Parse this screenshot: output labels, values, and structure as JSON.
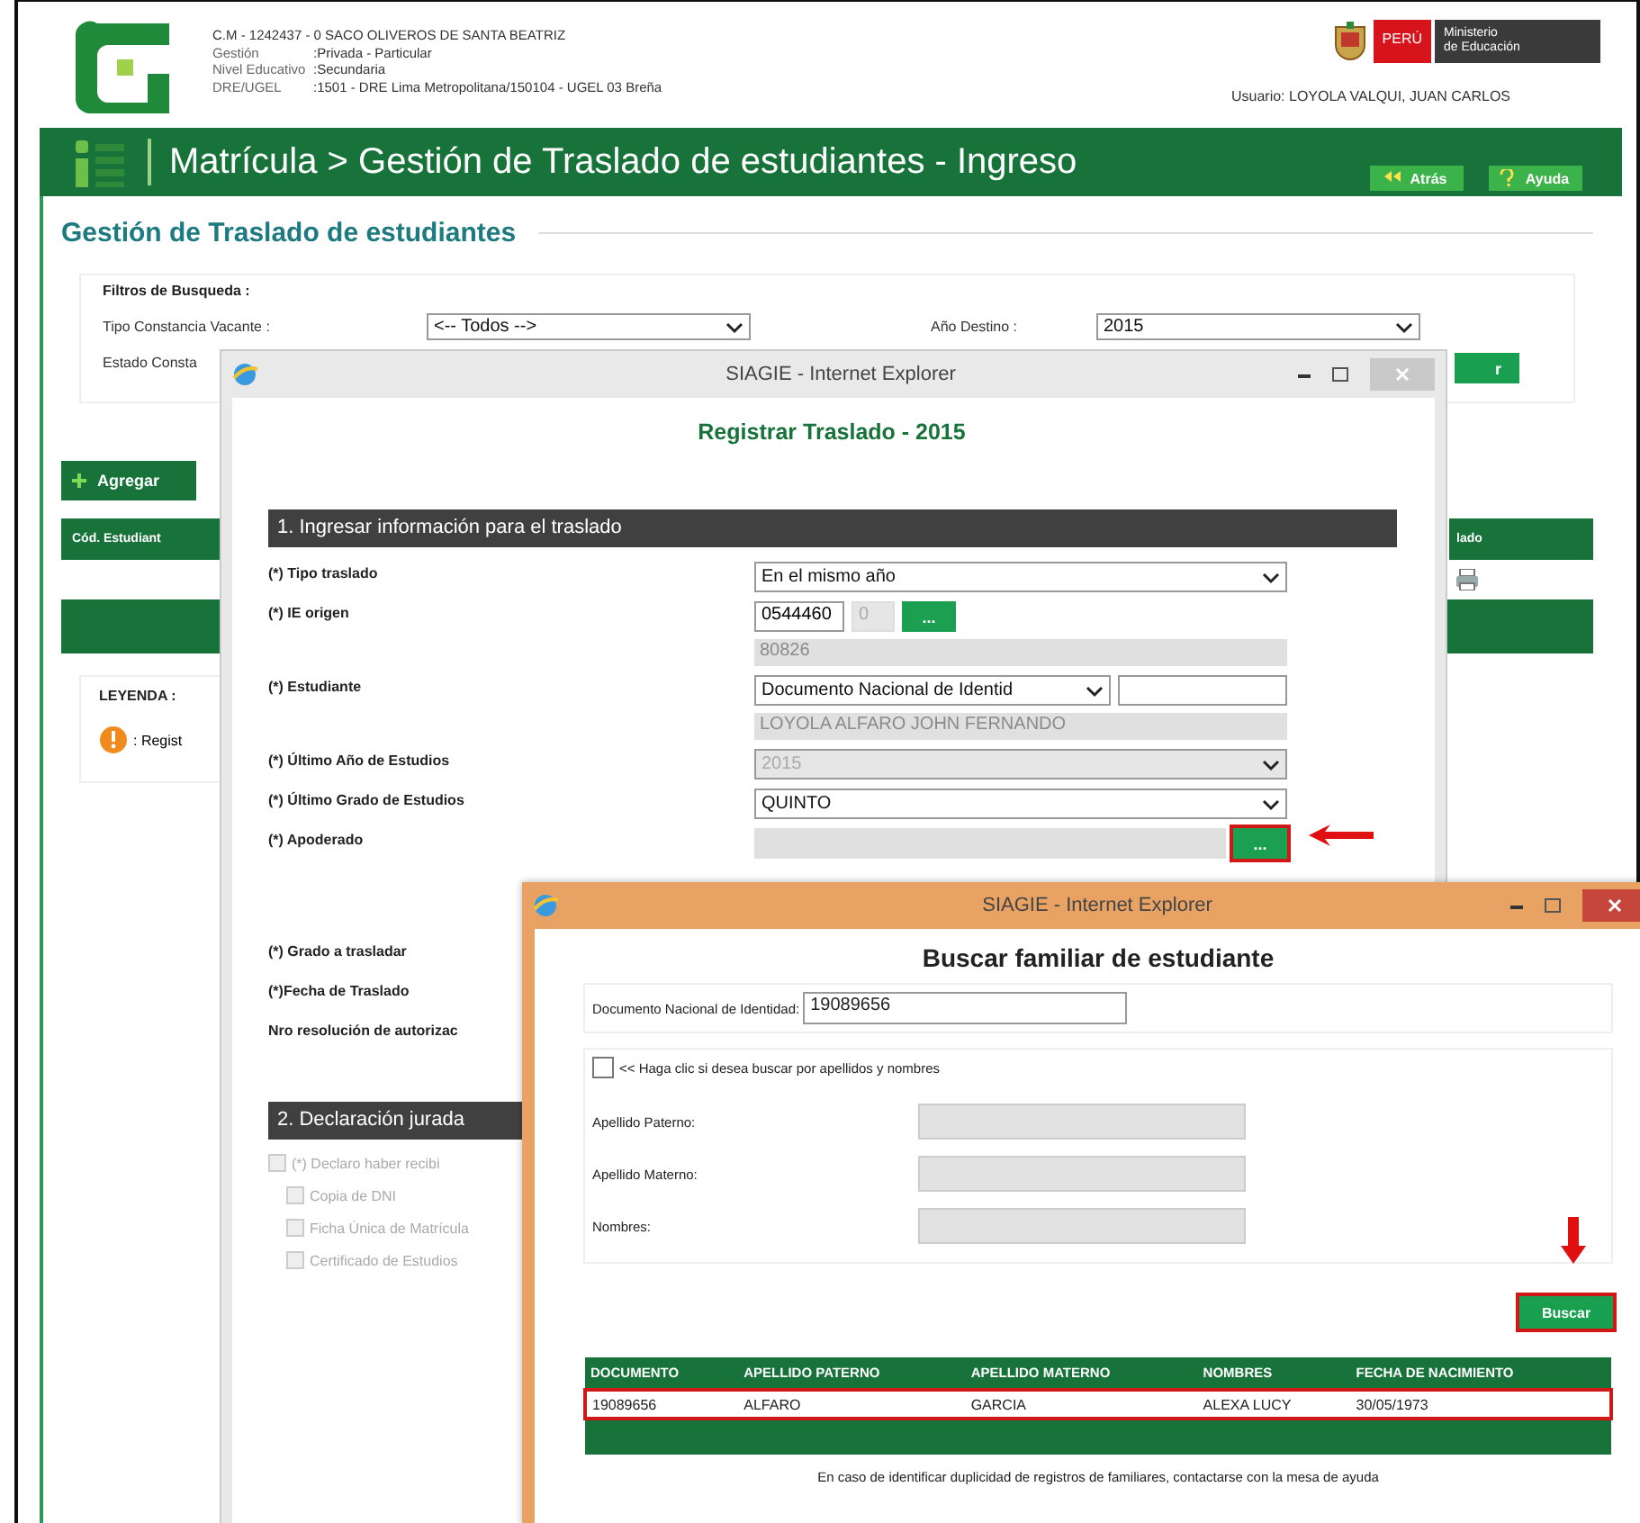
{
  "header": {
    "school": "C.M - 1242437 - 0  SACO OLIVEROS DE SANTA BEATRIZ",
    "info": [
      {
        "label": "Gestión",
        "value": ":Privada - Particular"
      },
      {
        "label": "Nivel Educativo",
        "value": ":Secundaria"
      },
      {
        "label": "DRE/UGEL",
        "value": ":1501 - DRE Lima Metropolitana/150104 - UGEL 03 Breña"
      }
    ],
    "country": "PERÚ",
    "ministry": [
      "Ministerio",
      "de Educación"
    ],
    "user": "Usuario: LOYOLA VALQUI, JUAN CARLOS"
  },
  "nav": {
    "breadcrumb": "Matrícula > Gestión de Traslado de estudiantes - Ingreso",
    "buttons": [
      {
        "kind": "back",
        "label": "Atrás"
      },
      {
        "kind": "help",
        "label": "Ayuda"
      }
    ]
  },
  "page_title": "Gestión de Traslado de estudiantes",
  "filters": {
    "legend": "Filtros de Busqueda :",
    "fields": [
      {
        "label": "Tipo Constancia Vacante :",
        "value": "<-- Todos -->"
      },
      {
        "label": "Año Destino :",
        "value": "2015"
      },
      {
        "label": "Estado Consta"
      }
    ],
    "button": "r"
  },
  "add_button": "Agregar",
  "table": {
    "columns": [
      "Cód. Estudiant",
      "lado"
    ]
  },
  "legend": {
    "title": "LEYENDA :",
    "item": ": Regist"
  },
  "register_window": {
    "title": "SIAGIE - Internet Explorer",
    "active": false,
    "heading": "Registrar Traslado - 2015",
    "section_1": "1. Ingresar información para el traslado",
    "rows": [
      {
        "kind": "select",
        "label": "(*) Tipo traslado",
        "value": "En el mismo año",
        "disabled": false
      },
      {
        "kind": "code",
        "label": "(*) IE origen",
        "value": "0544460",
        "suffix": "0",
        "button": "...",
        "note": "80826"
      },
      {
        "kind": "document",
        "label": "(*) Estudiante",
        "value": "Documento Nacional de Identid",
        "note": "LOYOLA ALFARO JOHN FERNANDO"
      },
      {
        "kind": "select",
        "label": "(*) Último Año de Estudios",
        "value": "2015",
        "disabled": true
      },
      {
        "kind": "select",
        "label": "(*) Último Grado de Estudios",
        "value": "QUINTO",
        "disabled": false
      },
      {
        "kind": "lookup",
        "label": "(*) Apoderado",
        "button": "...",
        "highlighted": true
      },
      {
        "kind": "label",
        "label": "(*) Grado a trasladar"
      },
      {
        "kind": "label",
        "label": "(*)Fecha de Traslado"
      },
      {
        "kind": "label",
        "label": "Nro resolución de autorizac"
      }
    ],
    "section_2": "2. Declaración jurada",
    "declarations": [
      {
        "label": "(*) Declaro haber recibi",
        "checked": false,
        "disabled": true,
        "children": [
          {
            "label": "Copia de DNI",
            "checked": false,
            "disabled": true
          },
          {
            "label": "Ficha Única de Matrícula",
            "checked": false,
            "disabled": true
          },
          {
            "label": "Certificado de Estudios",
            "checked": false,
            "disabled": true
          }
        ]
      }
    ]
  },
  "search_window": {
    "title": "SIAGIE - Internet Explorer",
    "active": true,
    "heading": "Buscar familiar de estudiante",
    "document": {
      "label": "Documento Nacional de Identidad:",
      "value": "19089656"
    },
    "toggle": {
      "label": "<< Haga clic si desea buscar por apellidos y nombres",
      "checked": false
    },
    "fields": [
      {
        "label": "Apellido Paterno:",
        "disabled": true
      },
      {
        "label": "Apellido Materno:",
        "disabled": true
      },
      {
        "label": "Nombres:",
        "disabled": true
      }
    ],
    "button": {
      "label": "Buscar",
      "highlighted": true
    },
    "results": {
      "columns": [
        "DOCUMENTO",
        "APELLIDO PATERNO",
        "APELLIDO MATERNO",
        "NOMBRES",
        "FECHA DE NACIMIENTO"
      ],
      "rows": [
        {
          "cells": [
            "19089656",
            "ALFARO",
            "GARCIA",
            "ALEXA LUCY",
            "30/05/1973"
          ],
          "highlighted": true
        }
      ]
    },
    "note": "En caso de identificar duplicidad de registros de familiares, contactarse con la mesa de ayuda"
  }
}
